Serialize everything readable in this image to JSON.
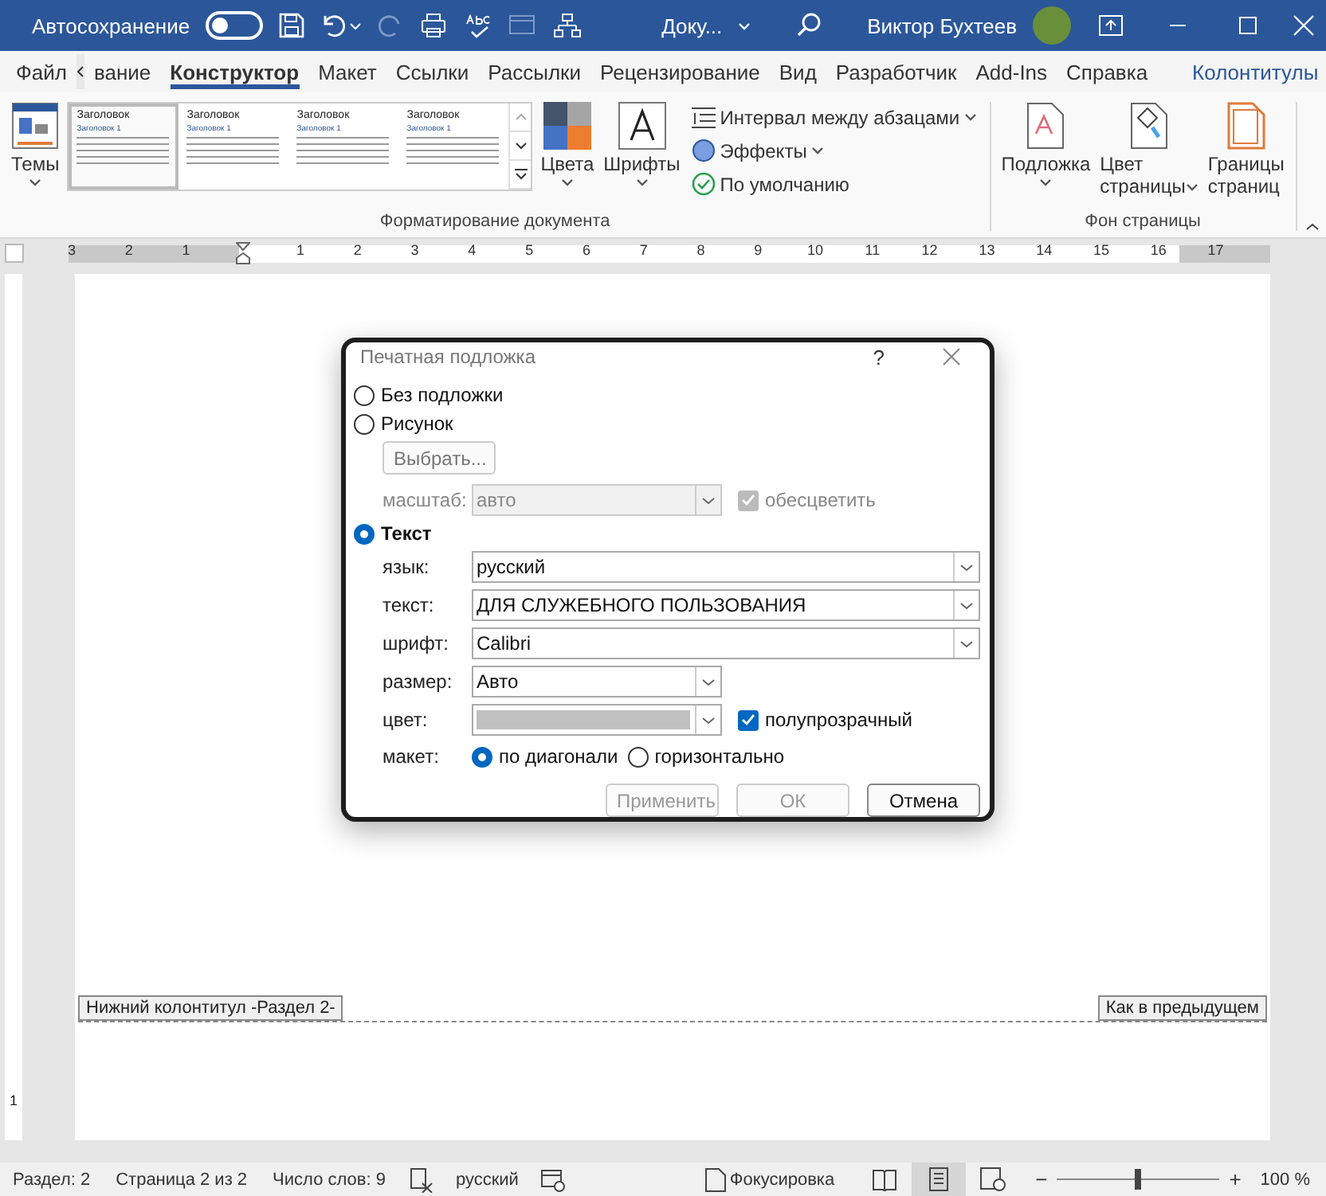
{
  "title_bar": {
    "autosave_label": "Автосохранение",
    "autosave_on": false,
    "document_title": "Доку...",
    "user_name": "Виктор Бухтеев"
  },
  "tabs": [
    {
      "label": "Файл",
      "selected": false,
      "kind": "tab"
    },
    {
      "label": "вание",
      "selected": false,
      "kind": "tab"
    },
    {
      "label": "Конструктор",
      "selected": true,
      "kind": "tab"
    },
    {
      "label": "Макет",
      "selected": false,
      "kind": "tab"
    },
    {
      "label": "Ссылки",
      "selected": false,
      "kind": "tab"
    },
    {
      "label": "Рассылки",
      "selected": false,
      "kind": "tab"
    },
    {
      "label": "Рецензирование",
      "selected": false,
      "kind": "tab"
    },
    {
      "label": "Вид",
      "selected": false,
      "kind": "tab"
    },
    {
      "label": "Разработчик",
      "selected": false,
      "kind": "tab"
    },
    {
      "label": "Add-Ins",
      "selected": false,
      "kind": "tab"
    },
    {
      "label": "Справка",
      "selected": false,
      "kind": "tab"
    },
    {
      "label": "Колонтитулы",
      "selected": false,
      "kind": "context"
    }
  ],
  "ribbon": {
    "format_group": {
      "name": "Форматирование документа",
      "themes": {
        "label": "Темы",
        "dropdown": true
      },
      "gallery": [
        {
          "heading": "Заголовок",
          "subheading": "Заголовок 1",
          "selected": true
        },
        {
          "heading": "Заголовок",
          "subheading": "Заголовок 1",
          "selected": false
        },
        {
          "heading": "Заголовок",
          "subheading": "Заголовок 1",
          "selected": false
        },
        {
          "heading": "Заголовок",
          "subheading": "Заголовок 1",
          "selected": false
        }
      ],
      "big_buttons": [
        {
          "label": "Цвета",
          "kind": "colors",
          "dropdown": true
        },
        {
          "label": "Шрифты",
          "kind": "fonts",
          "dropdown": true
        }
      ],
      "small_buttons": [
        {
          "label": "Интервал между абзацами",
          "kind": "spacing",
          "dropdown": true
        },
        {
          "label": "Эффекты",
          "kind": "effects",
          "dropdown": true
        },
        {
          "label": "По умолчанию",
          "kind": "default",
          "dropdown": false
        }
      ]
    },
    "background_group": {
      "name": "Фон страницы",
      "buttons": [
        {
          "lines": [
            "Подложка"
          ],
          "kind": "watermark",
          "dropdown": true
        },
        {
          "lines": [
            "Цвет",
            "страницы"
          ],
          "kind": "page-color",
          "dropdown": true
        },
        {
          "lines": [
            "Границы",
            "страниц"
          ],
          "kind": "borders",
          "dropdown": false
        }
      ]
    }
  },
  "ruler": {
    "left_margin_labels": [
      "3",
      "2",
      "1"
    ],
    "labels": [
      "1",
      "2",
      "3",
      "4",
      "5",
      "6",
      "7",
      "8",
      "9",
      "10",
      "11",
      "12",
      "13",
      "14",
      "15",
      "16",
      "17"
    ]
  },
  "vertical_ruler": {
    "labels": [
      "1"
    ]
  },
  "page": {
    "footer_label": "Нижний колонтитул -Раздел 2-",
    "link_label": "Как в предыдущем"
  },
  "dialog": {
    "title": "Печатная подложка",
    "help": "?",
    "no_watermark": {
      "label": "Без подложки",
      "selected": false
    },
    "picture": {
      "label": "Рисунок",
      "selected": false,
      "select_button": "Выбрать...",
      "scale_label": "масштаб:",
      "scale_value": "авто",
      "washout_label": "обесцветить",
      "washout_checked": true,
      "disabled": true
    },
    "text": {
      "label": "Текст",
      "selected": true,
      "fields": [
        {
          "label": "язык:",
          "value": "русский",
          "kind": "wide"
        },
        {
          "label": "текст:",
          "value": "ДЛЯ СЛУЖЕБНОГО ПОЛЬЗОВАНИЯ",
          "kind": "wide"
        },
        {
          "label": "шрифт:",
          "value": "Calibri",
          "kind": "wide"
        },
        {
          "label": "размер:",
          "value": "Авто",
          "kind": "short"
        },
        {
          "label": "цвет:",
          "color": "#c0c0c0",
          "kind": "color",
          "option_label": "полупрозрачный",
          "option_checked": true
        }
      ],
      "layout_label": "макет:",
      "layout_options": [
        {
          "label": "по диагонали",
          "selected": true
        },
        {
          "label": "горизонтально",
          "selected": false
        }
      ]
    },
    "buttons": [
      {
        "label": "Применить",
        "disabled": true
      },
      {
        "label": "ОК",
        "disabled": true
      },
      {
        "label": "Отмена",
        "disabled": false
      }
    ]
  },
  "status_bar": {
    "section": "Раздел: 2",
    "page": "Страница 2 из 2",
    "words": "Число слов: 9",
    "language": "русский",
    "focus": "Фокусировка",
    "views": [
      {
        "kind": "read",
        "selected": false
      },
      {
        "kind": "print",
        "selected": true
      },
      {
        "kind": "web",
        "selected": false
      }
    ],
    "zoom_minus": "−",
    "zoom_plus": "+",
    "zoom": {
      "level": 0.5
    },
    "zoom_label": "100 %"
  }
}
